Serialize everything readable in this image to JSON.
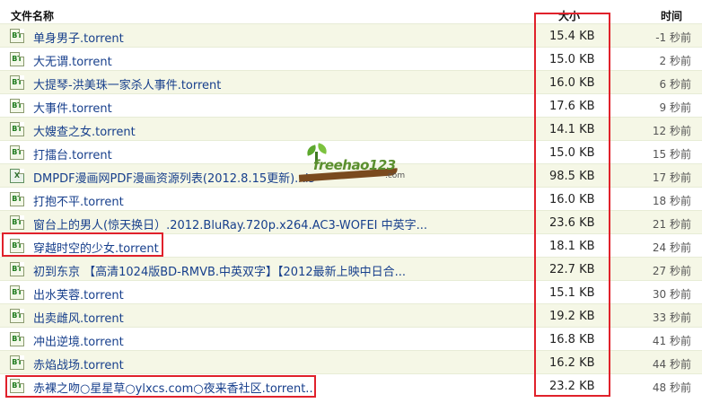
{
  "header": {
    "name_label": "文件名称",
    "size_label": "大小",
    "time_label": "时间"
  },
  "logo": {
    "text": "freehao123",
    "suffix": ".com"
  },
  "files": [
    {
      "name": "单身男子.torrent",
      "size": "15.4 KB",
      "time": "-1 秒前",
      "icon": "bt"
    },
    {
      "name": "大无谓.torrent",
      "size": "15.0 KB",
      "time": "2 秒前",
      "icon": "bt"
    },
    {
      "name": "大提琴-洪美珠一家杀人事件.torrent",
      "size": "16.0 KB",
      "time": "6 秒前",
      "icon": "bt"
    },
    {
      "name": "大事件.torrent",
      "size": "17.6 KB",
      "time": "9 秒前",
      "icon": "bt"
    },
    {
      "name": "大嫂查之女.torrent",
      "size": "14.1 KB",
      "time": "12 秒前",
      "icon": "bt"
    },
    {
      "name": "打擂台.torrent",
      "size": "15.0 KB",
      "time": "15 秒前",
      "icon": "bt"
    },
    {
      "name": "DMPDF漫画网PDF漫画资源列表(2012.8.15更新).xls",
      "size": "98.5 KB",
      "time": "17 秒前",
      "icon": "xls"
    },
    {
      "name": "打抱不平.torrent",
      "size": "16.0 KB",
      "time": "18 秒前",
      "icon": "bt"
    },
    {
      "name": "窗台上的男人(惊天换日）.2012.BluRay.720p.x264.AC3-WOFEI 中英字...",
      "size": "23.6 KB",
      "time": "21 秒前",
      "icon": "bt"
    },
    {
      "name": "穿越时空的少女.torrent",
      "size": "18.1 KB",
      "time": "24 秒前",
      "icon": "bt"
    },
    {
      "name": "初到东京 【高清1024版BD-RMVB.中英双字】【2012最新上映中日合...",
      "size": "22.7 KB",
      "time": "27 秒前",
      "icon": "bt"
    },
    {
      "name": "出水芙蓉.torrent",
      "size": "15.1 KB",
      "time": "30 秒前",
      "icon": "bt"
    },
    {
      "name": "出卖雌风.torrent",
      "size": "19.2 KB",
      "time": "33 秒前",
      "icon": "bt"
    },
    {
      "name": "冲出逆境.torrent",
      "size": "16.8 KB",
      "time": "41 秒前",
      "icon": "bt"
    },
    {
      "name": "赤焰战场.torrent",
      "size": "16.2 KB",
      "time": "44 秒前",
      "icon": "bt"
    },
    {
      "name": "赤裸之吻○星星草○ylxcs.com○夜来香社区.torrent...",
      "size": "23.2 KB",
      "time": "48 秒前",
      "icon": "bt"
    }
  ],
  "icon_text": {
    "bt": "BT",
    "xls": "X"
  },
  "colors": {
    "highlight": "#e0212b",
    "link": "#173f8c",
    "row_alt": "#f5f7e6"
  }
}
